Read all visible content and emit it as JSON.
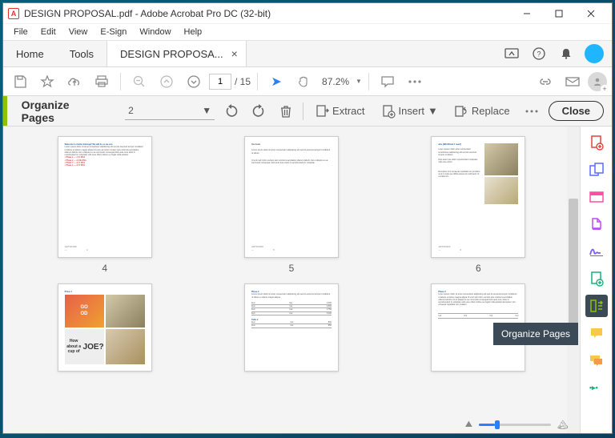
{
  "window": {
    "title": "DESIGN PROPOSAL.pdf - Adobe Acrobat Pro DC (32-bit)",
    "app_badge": "A"
  },
  "menu": {
    "items": [
      "File",
      "Edit",
      "View",
      "E-Sign",
      "Window",
      "Help"
    ]
  },
  "tabs": {
    "home": "Home",
    "tools": "Tools",
    "doc": "DESIGN PROPOSA..."
  },
  "toolbar": {
    "page_current": "1",
    "page_total": "/ 15",
    "zoom": "87.2%"
  },
  "organize": {
    "title": "Organize Pages",
    "dropdown_value": "2",
    "extract": "Extract",
    "insert": "Insert",
    "replace": "Replace",
    "close": "Close"
  },
  "thumbs": {
    "labels": [
      "4",
      "5",
      "6"
    ]
  },
  "tooltip": {
    "text": "Organize Pages"
  }
}
